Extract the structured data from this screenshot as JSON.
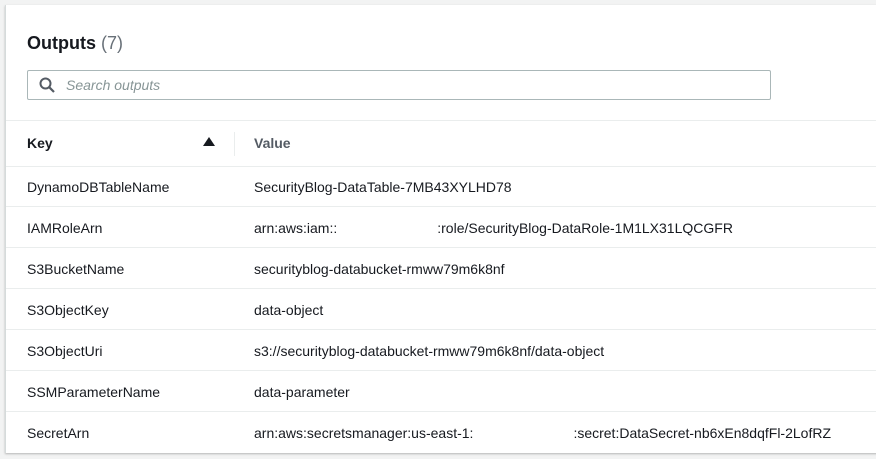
{
  "title": "Outputs",
  "count": "(7)",
  "search": {
    "placeholder": "Search outputs"
  },
  "columns": {
    "key": "Key",
    "value": "Value"
  },
  "rows": [
    {
      "key": "DynamoDBTableName",
      "value": "SecurityBlog-DataTable-7MB43XYLHD78",
      "value_suffix": ""
    },
    {
      "key": "IAMRoleArn",
      "value": "arn:aws:iam::",
      "value_suffix": ":role/SecurityBlog-DataRole-1M1LX31LQCGFR"
    },
    {
      "key": "S3BucketName",
      "value": "securityblog-databucket-rmww79m6k8nf",
      "value_suffix": ""
    },
    {
      "key": "S3ObjectKey",
      "value": "data-object",
      "value_suffix": ""
    },
    {
      "key": "S3ObjectUri",
      "value": "s3://securityblog-databucket-rmww79m6k8nf/data-object",
      "value_suffix": ""
    },
    {
      "key": "SSMParameterName",
      "value": "data-parameter",
      "value_suffix": ""
    },
    {
      "key": "SecretArn",
      "value": "arn:aws:secretsmanager:us-east-1:",
      "value_suffix": ":secret:DataSecret-nb6xEn8dqfFl-2LofRZ"
    }
  ]
}
